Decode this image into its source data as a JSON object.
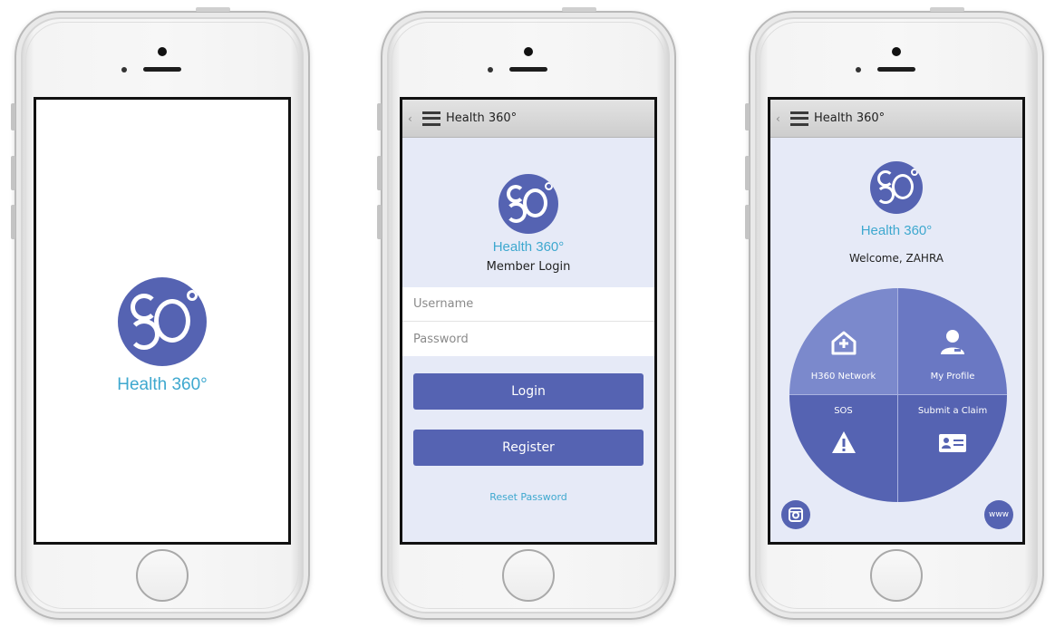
{
  "brand": {
    "name": "Health 360°",
    "accent": "#5563b2",
    "teal": "#3ea8cf"
  },
  "splash": {
    "brand_label": "Health 360°"
  },
  "login": {
    "app_title": "Health 360°",
    "brand_label": "Health 360°",
    "subtitle": "Member Login",
    "username_placeholder": "Username",
    "password_placeholder": "Password",
    "login_label": "Login",
    "register_label": "Register",
    "reset_label": "Reset Password"
  },
  "dashboard": {
    "app_title": "Health 360°",
    "brand_label": "Health 360°",
    "welcome": "Welcome, ZAHRA",
    "tiles": [
      {
        "label": "H360 Network",
        "icon": "home-plus-icon"
      },
      {
        "label": "My Profile",
        "icon": "user-icon"
      },
      {
        "label": "SOS",
        "icon": "warning-icon"
      },
      {
        "label": "Submit a Claim",
        "icon": "id-card-icon"
      }
    ],
    "www_label": "www"
  }
}
